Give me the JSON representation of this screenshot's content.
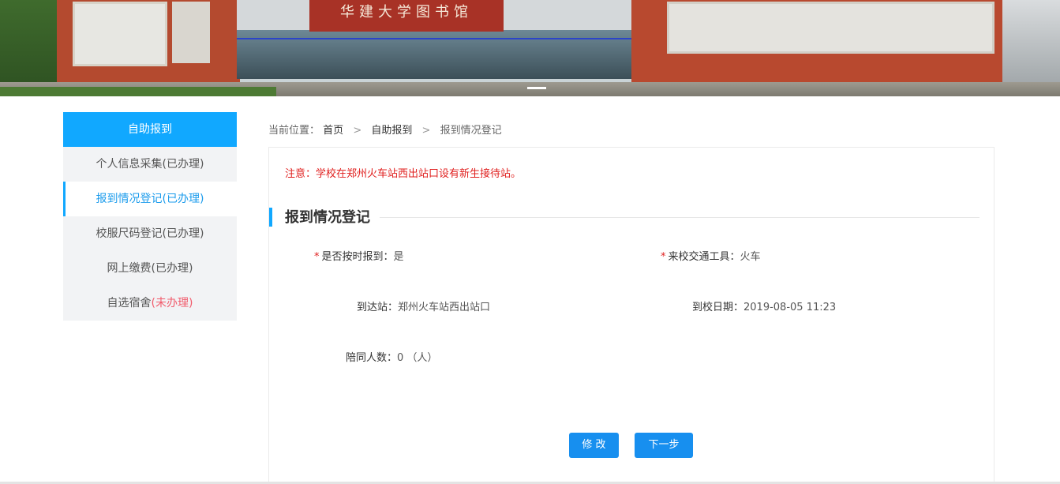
{
  "banner": {
    "sign_text": "华建大学图书馆"
  },
  "sidebar": {
    "header": "自助报到",
    "items": [
      {
        "label": "个人信息采集",
        "status": "(已办理)"
      },
      {
        "label": "报到情况登记",
        "status": "(已办理)"
      },
      {
        "label": "校服尺码登记",
        "status": "(已办理)"
      },
      {
        "label": "网上缴费",
        "status": "(已办理)"
      },
      {
        "label": "自选宿舍",
        "status": "(未办理)"
      }
    ]
  },
  "breadcrumb": {
    "prefix": "当前位置：",
    "items": [
      "首页",
      "自助报到",
      "报到情况登记"
    ],
    "separator": ">"
  },
  "notice": "注意：学校在郑州火车站西出站口设有新生接待站。",
  "section_title": "报到情况登记",
  "fields": {
    "on_time": {
      "label": "是否按时报到：",
      "value": "是"
    },
    "transport": {
      "label": "来校交通工具：",
      "value": "火车"
    },
    "station": {
      "label": "到达站：",
      "value": "郑州火车站西出站口"
    },
    "arrive_date": {
      "label": "到校日期：",
      "value": "2019-08-05 11:23"
    },
    "companions": {
      "label": "陪同人数：",
      "value": "0 （人）"
    }
  },
  "required_mark": "*",
  "buttons": {
    "edit": "修 改",
    "next": "下一步"
  },
  "colors": {
    "accent": "#11a8ff",
    "button": "#178fef",
    "warning": "#e0201f",
    "pending": "#f15b6c"
  }
}
